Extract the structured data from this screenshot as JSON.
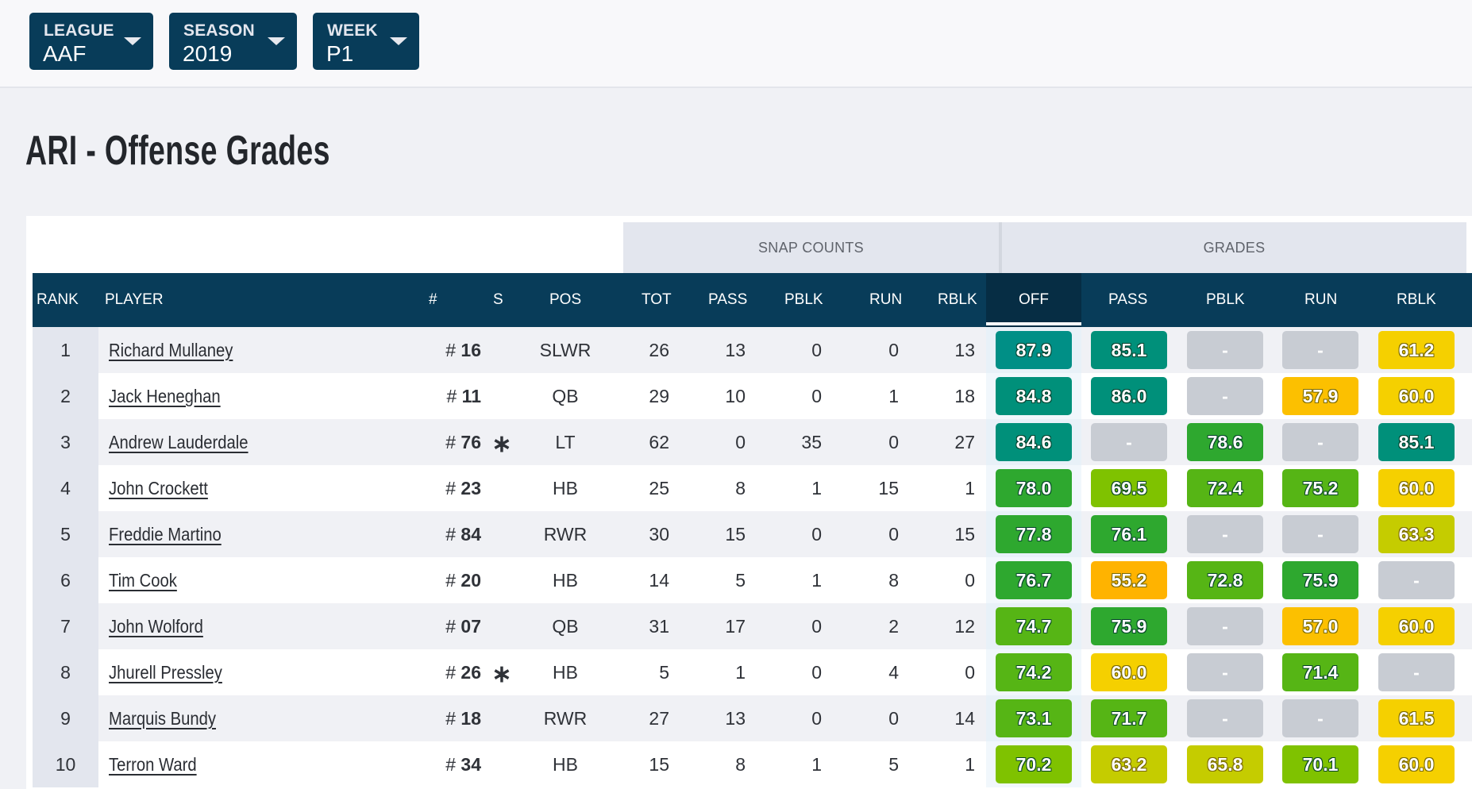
{
  "filters": {
    "league": {
      "label": "LEAGUE",
      "value": "AAF"
    },
    "season": {
      "label": "SEASON",
      "value": "2019"
    },
    "week": {
      "label": "WEEK",
      "value": "P1"
    }
  },
  "page_title": "ARI - Offense Grades",
  "table": {
    "group_headers": {
      "snap_counts": "SNAP COUNTS",
      "grades": "GRADES"
    },
    "columns": {
      "rank": "RANK",
      "player": "PLAYER",
      "jersey": "#",
      "starter": "S",
      "pos": "POS",
      "snap_tot": "TOT",
      "snap_pass": "PASS",
      "snap_pblk": "PBLK",
      "snap_run": "RUN",
      "snap_rblk": "RBLK",
      "grade_off": "OFF",
      "grade_pass": "PASS",
      "grade_pblk": "PBLK",
      "grade_run": "RUN",
      "grade_rblk": "RBLK"
    },
    "sorted_column": "OFF",
    "jersey_prefix": "#",
    "starter_marker": "∗",
    "empty_grade": "-",
    "grade_colors": {
      "elite": "#008f86",
      "high": "#00907a",
      "good": "#2ea82f",
      "above_avg": "#56b515",
      "average_plus": "#7fc200",
      "average": "#c5cc00",
      "below_avg": "#f5d000",
      "low": "#fcc000",
      "poor": "#ffb300",
      "none": "#c8ccd3"
    },
    "rows": [
      {
        "rank": "1",
        "player": "Richard Mullaney",
        "jersey": "16",
        "starter": "",
        "pos": "SLWR",
        "snaps": {
          "tot": "26",
          "pass": "13",
          "pblk": "0",
          "run": "0",
          "rblk": "13"
        },
        "grades": {
          "off": "87.9",
          "pass": "85.1",
          "pblk": "-",
          "run": "-",
          "rblk": "61.2"
        }
      },
      {
        "rank": "2",
        "player": "Jack Heneghan",
        "jersey": "11",
        "starter": "",
        "pos": "QB",
        "snaps": {
          "tot": "29",
          "pass": "10",
          "pblk": "0",
          "run": "1",
          "rblk": "18"
        },
        "grades": {
          "off": "84.8",
          "pass": "86.0",
          "pblk": "-",
          "run": "57.9",
          "rblk": "60.0"
        }
      },
      {
        "rank": "3",
        "player": "Andrew Lauderdale",
        "jersey": "76",
        "starter": "∗",
        "pos": "LT",
        "snaps": {
          "tot": "62",
          "pass": "0",
          "pblk": "35",
          "run": "0",
          "rblk": "27"
        },
        "grades": {
          "off": "84.6",
          "pass": "-",
          "pblk": "78.6",
          "run": "-",
          "rblk": "85.1"
        }
      },
      {
        "rank": "4",
        "player": "John Crockett",
        "jersey": "23",
        "starter": "",
        "pos": "HB",
        "snaps": {
          "tot": "25",
          "pass": "8",
          "pblk": "1",
          "run": "15",
          "rblk": "1"
        },
        "grades": {
          "off": "78.0",
          "pass": "69.5",
          "pblk": "72.4",
          "run": "75.2",
          "rblk": "60.0"
        }
      },
      {
        "rank": "5",
        "player": "Freddie Martino",
        "jersey": "84",
        "starter": "",
        "pos": "RWR",
        "snaps": {
          "tot": "30",
          "pass": "15",
          "pblk": "0",
          "run": "0",
          "rblk": "15"
        },
        "grades": {
          "off": "77.8",
          "pass": "76.1",
          "pblk": "-",
          "run": "-",
          "rblk": "63.3"
        }
      },
      {
        "rank": "6",
        "player": "Tim Cook",
        "jersey": "20",
        "starter": "",
        "pos": "HB",
        "snaps": {
          "tot": "14",
          "pass": "5",
          "pblk": "1",
          "run": "8",
          "rblk": "0"
        },
        "grades": {
          "off": "76.7",
          "pass": "55.2",
          "pblk": "72.8",
          "run": "75.9",
          "rblk": "-"
        }
      },
      {
        "rank": "7",
        "player": "John Wolford",
        "jersey": "07",
        "starter": "",
        "pos": "QB",
        "snaps": {
          "tot": "31",
          "pass": "17",
          "pblk": "0",
          "run": "2",
          "rblk": "12"
        },
        "grades": {
          "off": "74.7",
          "pass": "75.9",
          "pblk": "-",
          "run": "57.0",
          "rblk": "60.0"
        }
      },
      {
        "rank": "8",
        "player": "Jhurell Pressley",
        "jersey": "26",
        "starter": "∗",
        "pos": "HB",
        "snaps": {
          "tot": "5",
          "pass": "1",
          "pblk": "0",
          "run": "4",
          "rblk": "0"
        },
        "grades": {
          "off": "74.2",
          "pass": "60.0",
          "pblk": "-",
          "run": "71.4",
          "rblk": "-"
        }
      },
      {
        "rank": "9",
        "player": "Marquis Bundy",
        "jersey": "18",
        "starter": "",
        "pos": "RWR",
        "snaps": {
          "tot": "27",
          "pass": "13",
          "pblk": "0",
          "run": "0",
          "rblk": "14"
        },
        "grades": {
          "off": "73.1",
          "pass": "71.7",
          "pblk": "-",
          "run": "-",
          "rblk": "61.5"
        }
      },
      {
        "rank": "10",
        "player": "Terron Ward",
        "jersey": "34",
        "starter": "",
        "pos": "HB",
        "snaps": {
          "tot": "15",
          "pass": "8",
          "pblk": "1",
          "run": "5",
          "rblk": "1"
        },
        "grades": {
          "off": "70.2",
          "pass": "63.2",
          "pblk": "65.8",
          "run": "70.1",
          "rblk": "60.0"
        }
      }
    ]
  }
}
